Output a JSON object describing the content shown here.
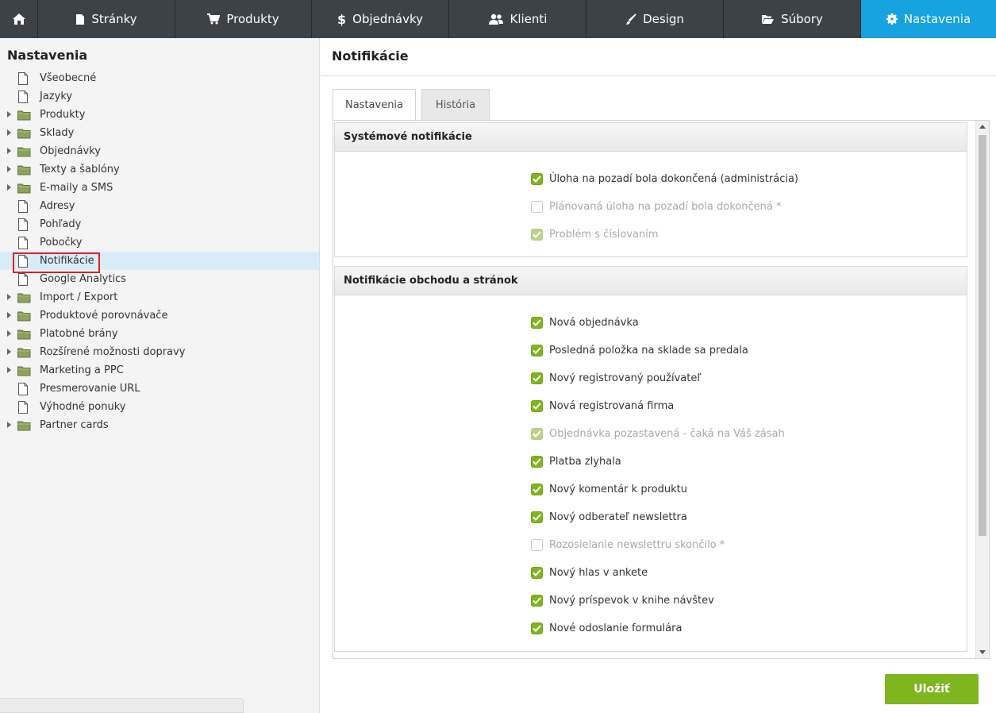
{
  "nav": {
    "items": [
      {
        "label": "Stránky",
        "icon": "page-icon"
      },
      {
        "label": "Produkty",
        "icon": "cart-icon"
      },
      {
        "label": "Objednávky",
        "icon": "dollar-icon"
      },
      {
        "label": "Klienti",
        "icon": "users-icon"
      },
      {
        "label": "Design",
        "icon": "brush-icon"
      },
      {
        "label": "Súbory",
        "icon": "folder-open-icon"
      },
      {
        "label": "Nastavenia",
        "icon": "gear-icon"
      }
    ],
    "active": "Nastavenia",
    "colors": {
      "bar": "#3c4246",
      "active": "#16a3e0"
    }
  },
  "sidebar": {
    "title": "Nastavenia",
    "items": [
      {
        "label": "Všeobecné",
        "type": "page"
      },
      {
        "label": "Jazyky",
        "type": "page"
      },
      {
        "label": "Produkty",
        "type": "folder"
      },
      {
        "label": "Sklady",
        "type": "folder"
      },
      {
        "label": "Objednávky",
        "type": "folder"
      },
      {
        "label": "Texty a šablóny",
        "type": "folder"
      },
      {
        "label": "E-maily a SMS",
        "type": "folder"
      },
      {
        "label": "Adresy",
        "type": "page"
      },
      {
        "label": "Pohľady",
        "type": "page"
      },
      {
        "label": "Pobočky",
        "type": "page"
      },
      {
        "label": "Notifikácie",
        "type": "page"
      },
      {
        "label": "Google Analytics",
        "type": "page"
      },
      {
        "label": "Import / Export",
        "type": "folder"
      },
      {
        "label": "Produktové porovnávače",
        "type": "folder"
      },
      {
        "label": "Platobné brány",
        "type": "folder"
      },
      {
        "label": "Rozšírené možnosti dopravy",
        "type": "folder"
      },
      {
        "label": "Marketing a PPC",
        "type": "folder"
      },
      {
        "label": "Presmerovanie URL",
        "type": "page"
      },
      {
        "label": "Výhodné ponuky",
        "type": "page"
      },
      {
        "label": "Partner cards",
        "type": "folder"
      }
    ],
    "selected": "Notifikácie"
  },
  "main": {
    "title": "Notifikácie",
    "tabs": [
      {
        "label": "Nastavenia",
        "active": true
      },
      {
        "label": "História",
        "active": false
      }
    ],
    "sections": [
      {
        "title": "Systémové notifikácie",
        "items": [
          {
            "label": "Úloha na pozadí bola dokončená (administrácia)",
            "state": "on"
          },
          {
            "label": "Plánovaná úloha na pozadí bola dokončená *",
            "state": "off"
          },
          {
            "label": "Problém s číslovaním",
            "state": "on-dis"
          }
        ]
      },
      {
        "title": "Notifikácie obchodu a stránok",
        "items": [
          {
            "label": "Nová objednávka",
            "state": "on"
          },
          {
            "label": "Posledná položka na sklade sa predala",
            "state": "on"
          },
          {
            "label": "Nový registrovaný používateľ",
            "state": "on"
          },
          {
            "label": "Nová registrovaná firma",
            "state": "on"
          },
          {
            "label": "Objednávka pozastavená - čaká na Váš zásah",
            "state": "on-dis"
          },
          {
            "label": "Platba zlyhala",
            "state": "on"
          },
          {
            "label": "Nový komentár k produktu",
            "state": "on"
          },
          {
            "label": "Nový odberateľ newslettra",
            "state": "on"
          },
          {
            "label": "Rozosielanie newslettru skončilo *",
            "state": "off"
          },
          {
            "label": "Nový hlas v ankete",
            "state": "on"
          },
          {
            "label": "Nový príspevok v knihe návštev",
            "state": "on"
          },
          {
            "label": "Nové odoslanie formulára",
            "state": "on"
          }
        ]
      }
    ],
    "save_label": "Uložiť",
    "colors": {
      "accent": "#7fb51f"
    }
  }
}
